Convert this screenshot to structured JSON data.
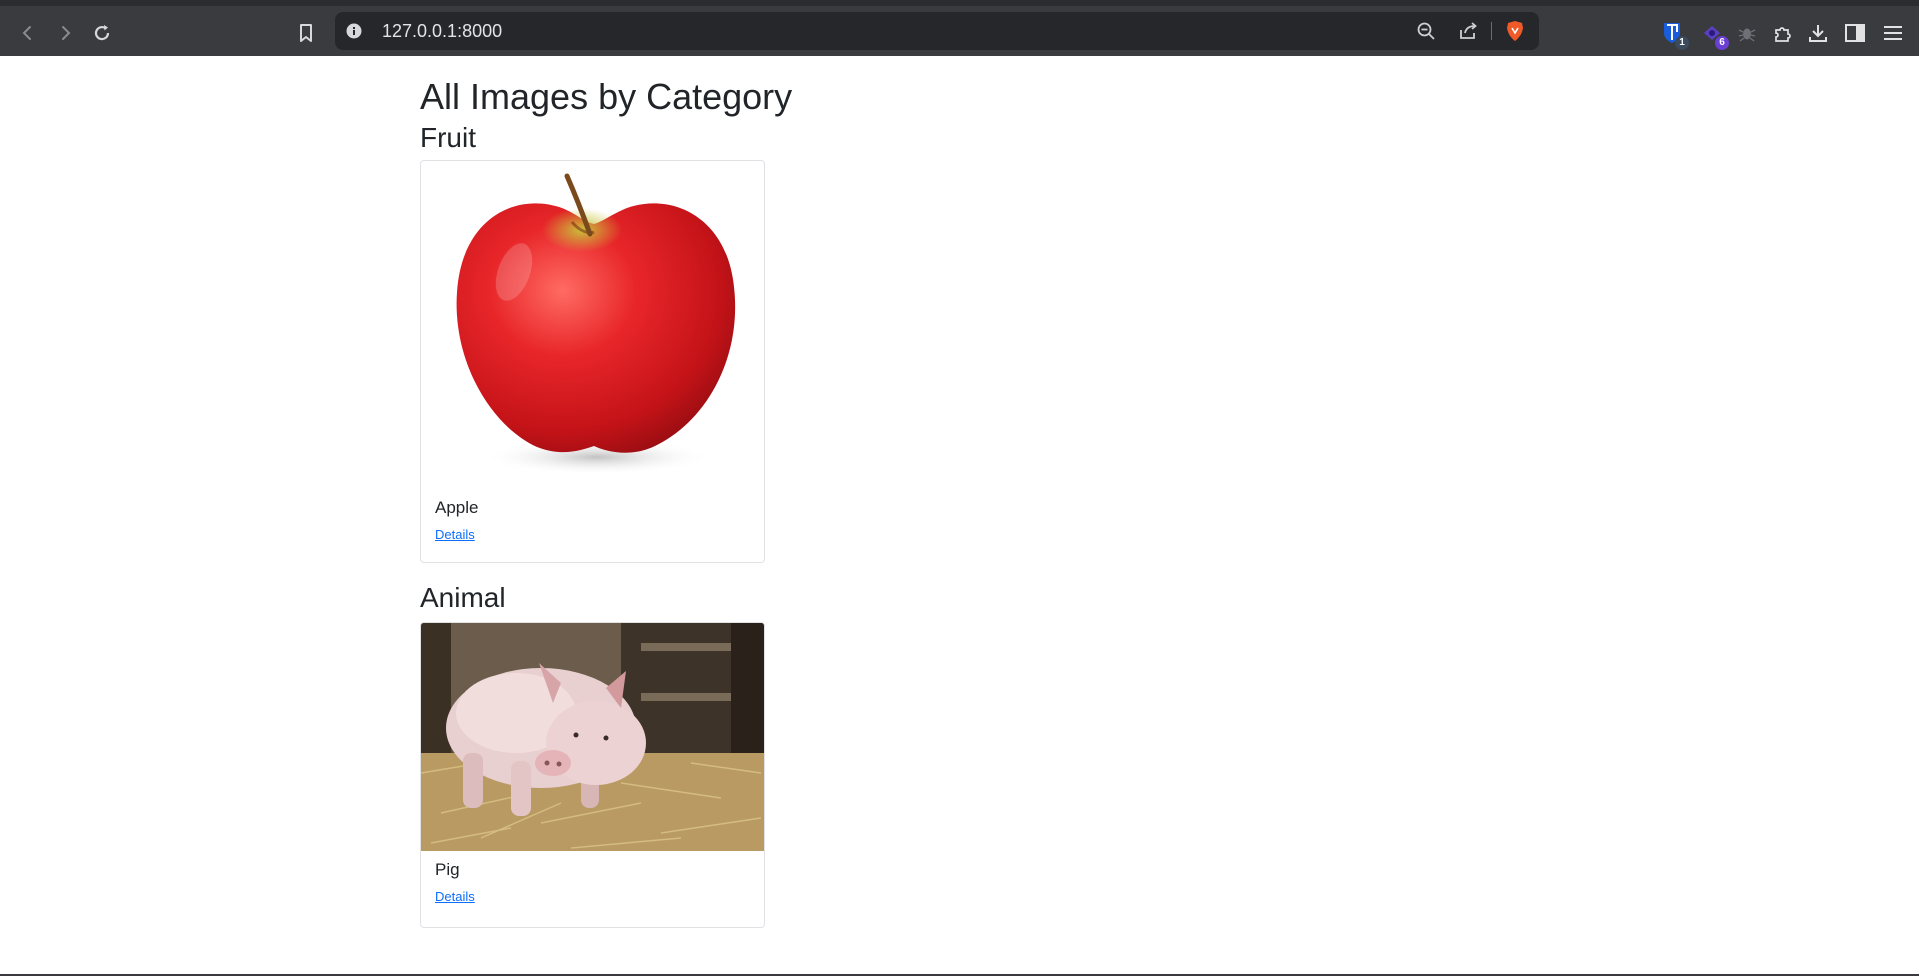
{
  "browser": {
    "url": "127.0.0.1:8000",
    "extension_badges": [
      "1",
      "6"
    ],
    "accent_brave": "#f05a28"
  },
  "page": {
    "title": "All Images by Category",
    "categories": [
      {
        "name": "Fruit",
        "items": [
          {
            "title": "Apple",
            "link_label": "Details",
            "image": "apple"
          }
        ]
      },
      {
        "name": "Animal",
        "items": [
          {
            "title": "Pig",
            "link_label": "Details",
            "image": "pig"
          }
        ]
      }
    ]
  },
  "colors": {
    "link": "#0d6efd",
    "heading": "#212529",
    "chrome": "#3a3b3f"
  }
}
